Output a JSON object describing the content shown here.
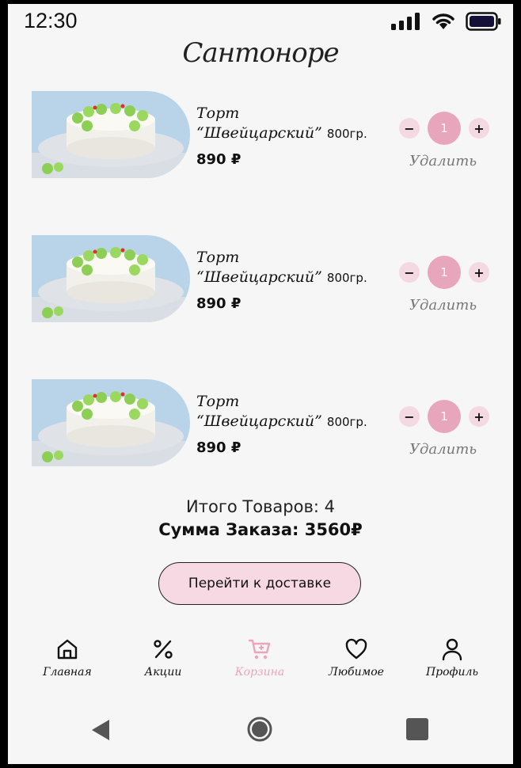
{
  "status": {
    "time": "12:30"
  },
  "brand": {
    "logo_text": "Сантоноре"
  },
  "cart": {
    "items": [
      {
        "name_line1": "Торт",
        "name_line2": "“Швейцарский”",
        "weight": "800гр.",
        "price": "890 ₽",
        "qty": "1",
        "remove": "Удалить",
        "minus": "−",
        "plus": "+"
      },
      {
        "name_line1": "Торт",
        "name_line2": "“Швейцарский”",
        "weight": "800гр.",
        "price": "890 ₽",
        "qty": "1",
        "remove": "Удалить",
        "minus": "−",
        "plus": "+"
      },
      {
        "name_line1": "Торт",
        "name_line2": "“Швейцарский”",
        "weight": "800гр.",
        "price": "890 ₽",
        "qty": "1",
        "remove": "Удалить",
        "minus": "−",
        "plus": "+"
      }
    ]
  },
  "summary": {
    "items_total": "Итого Товаров: 4",
    "order_sum": "Сумма Заказа: 3560₽",
    "cta": "Перейти к доставке"
  },
  "tabs": [
    {
      "label": "Главная",
      "icon": "home-icon"
    },
    {
      "label": "Акции",
      "icon": "percent-icon"
    },
    {
      "label": "Корзина",
      "icon": "cart-icon",
      "active": true
    },
    {
      "label": "Любимое",
      "icon": "heart-icon"
    },
    {
      "label": "Профиль",
      "icon": "profile-icon"
    }
  ],
  "colors": {
    "accent": "#e8a6bd",
    "accent_light": "#f4d9e2",
    "background": "#f6f6f6"
  }
}
